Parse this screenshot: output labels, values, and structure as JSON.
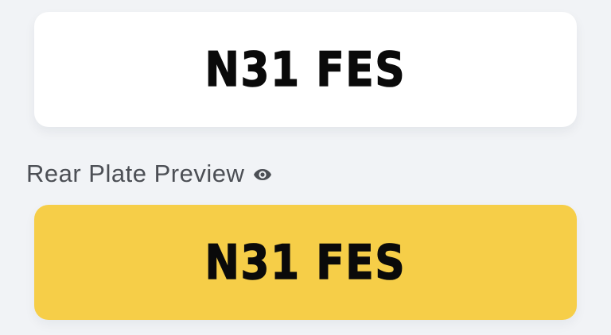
{
  "front_plate": {
    "registration": "N31 FES",
    "background_color": "#ffffff"
  },
  "rear_preview": {
    "label": "Rear Plate Preview",
    "icon": "eye-icon"
  },
  "rear_plate": {
    "registration": "N31 FES",
    "background_color": "#f6ce48"
  }
}
